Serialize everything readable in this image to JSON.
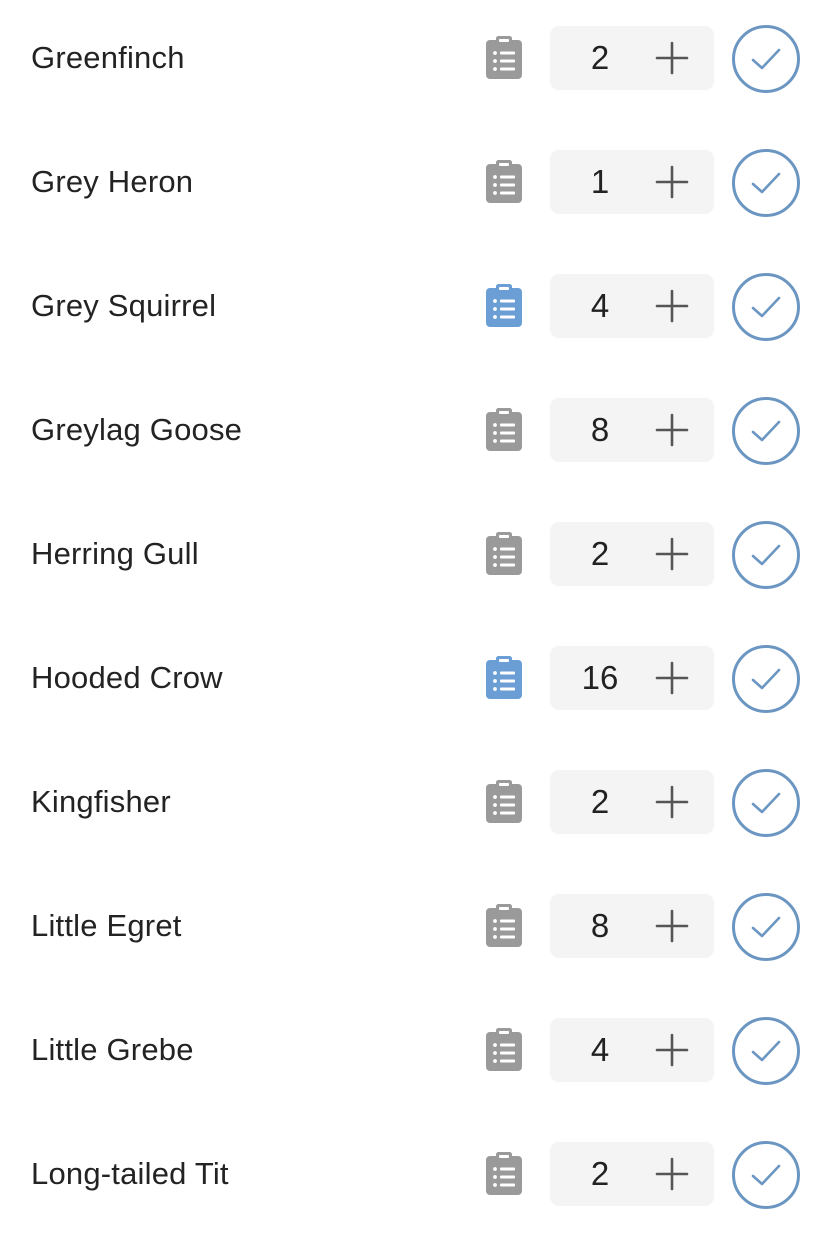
{
  "colors": {
    "note_default": "#9a9a9a",
    "note_active": "#6a9ed4",
    "check_accent": "#6b96c2",
    "stepper_bg": "#f4f4f4",
    "text": "#232323"
  },
  "icons": {
    "note": "clipboard-list-icon",
    "increment": "plus-icon",
    "confirm": "check-circle-icon"
  },
  "rows": [
    {
      "name": "Greenfinch",
      "count": "2",
      "note_active": false
    },
    {
      "name": "Grey Heron",
      "count": "1",
      "note_active": false
    },
    {
      "name": "Grey Squirrel",
      "count": "4",
      "note_active": true
    },
    {
      "name": "Greylag Goose",
      "count": "8",
      "note_active": false
    },
    {
      "name": "Herring Gull",
      "count": "2",
      "note_active": false
    },
    {
      "name": "Hooded Crow",
      "count": "16",
      "note_active": true
    },
    {
      "name": "Kingfisher",
      "count": "2",
      "note_active": false
    },
    {
      "name": "Little Egret",
      "count": "8",
      "note_active": false
    },
    {
      "name": "Little Grebe",
      "count": "4",
      "note_active": false
    },
    {
      "name": "Long-tailed Tit",
      "count": "2",
      "note_active": false
    }
  ]
}
